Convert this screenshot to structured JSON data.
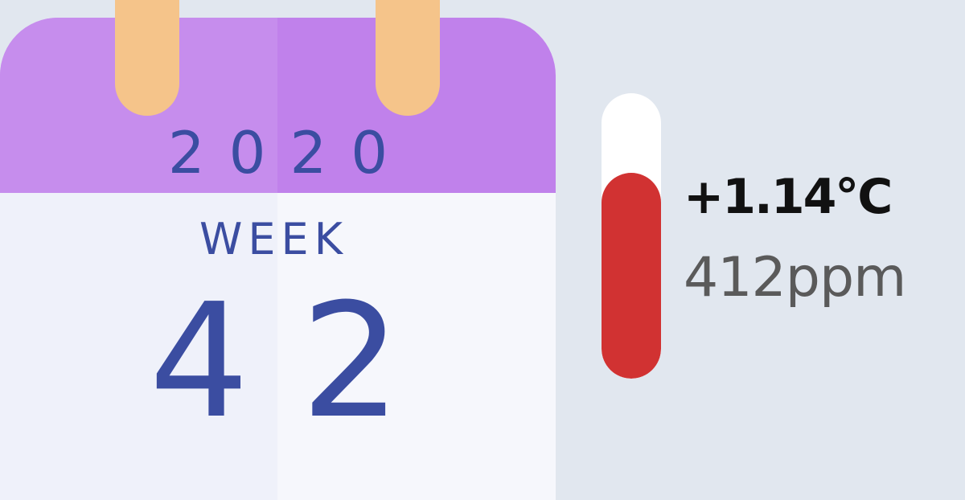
{
  "calendar": {
    "year": "2020",
    "week_label": "WEEK",
    "week_number": "42"
  },
  "climate": {
    "temperature_anomaly": "+1.14°C",
    "co2_level": "412ppm",
    "thermometer_level_percent": 72
  },
  "colors": {
    "background": "#e1e7ef",
    "calendar_header": "#c081eb",
    "calendar_body": "#f6f7fc",
    "calendar_text": "#3b4da1",
    "binder_rings": "#f5c48a",
    "thermometer_tube": "#ffffff",
    "thermometer_fill": "#d13232",
    "temperature_text": "#111111",
    "co2_text": "#5a5a5a"
  },
  "icons": {
    "calendar": "calendar-icon",
    "thermometer": "thermometer-icon"
  }
}
